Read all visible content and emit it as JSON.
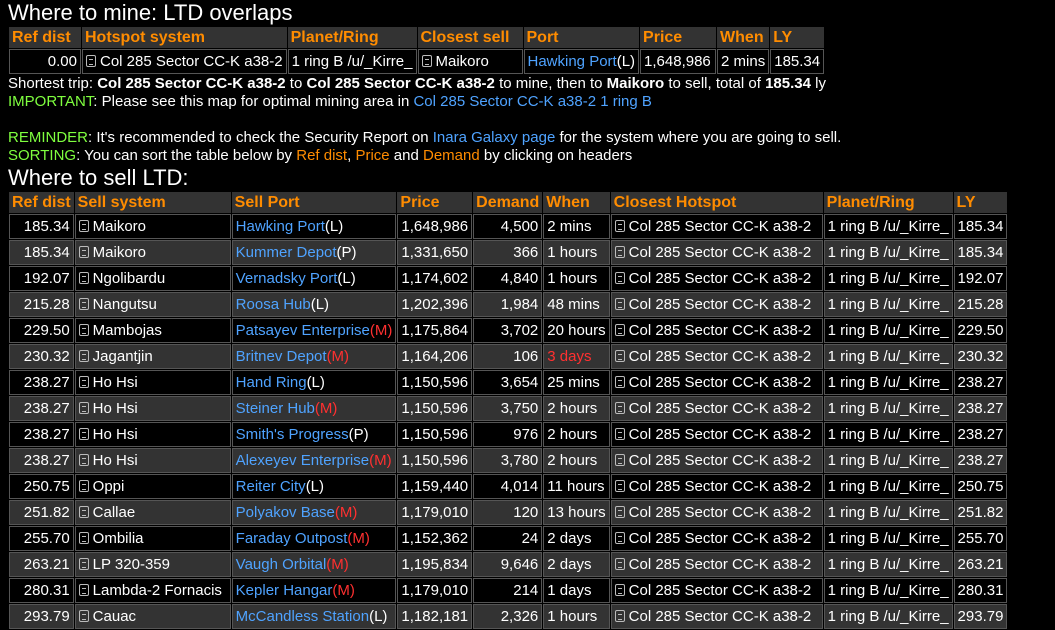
{
  "mine": {
    "title": "Where to mine: LTD overlaps",
    "headers": [
      "Ref dist",
      "Hotspot system",
      "Planet/Ring",
      "Closest sell",
      "Port",
      "Price",
      "When",
      "LY"
    ],
    "row": {
      "ref_dist": "0.00",
      "hotspot_system": "Col 285 Sector CC-K a38-2",
      "planet_ring": "1 ring B /u/_Kirre_",
      "closest_sell": "Maikoro",
      "port": "Hawking Port",
      "port_type": "(L)",
      "price": "1,648,986",
      "when": "2 mins",
      "ly": "185.34"
    }
  },
  "trip": {
    "lead": "Shortest trip:",
    "from": "Col 285 Sector CC-K a38-2",
    "to_word": "to",
    "to": "Col 285 Sector CC-K a38-2",
    "mine_then": "to mine, then to",
    "sell": "Maikoro",
    "sell_total": "to sell, total of",
    "total": "185.34",
    "unit": "ly"
  },
  "important": {
    "label": "IMPORTANT",
    "text": ": Please see this map for optimal mining area in",
    "link": "Col 285 Sector CC-K a38-2 1 ring B"
  },
  "reminder": {
    "label": "REMINDER",
    "text1": ": It's recommended to check the Security Report on",
    "link": "Inara Galaxy page",
    "text2": "for the system where you are going to sell."
  },
  "sorting": {
    "label": "SORTING",
    "text1": ": You can sort the table below by",
    "k1": "Ref dist",
    "sep": ",",
    "k2": "Price",
    "and": "and",
    "k3": "Demand",
    "text2": "by clicking on headers"
  },
  "sell": {
    "title": "Where to sell LTD:",
    "headers": [
      "Ref dist",
      "Sell system",
      "Sell Port",
      "Price",
      "Demand",
      "When",
      "Closest Hotspot",
      "Planet/Ring",
      "LY"
    ],
    "rows": [
      {
        "ref": "185.34",
        "system": "Maikoro",
        "port": "Hawking Port",
        "ptype": "(L)",
        "price": "1,648,986",
        "demand": "4,500",
        "when": "2 mins",
        "when_alert": false,
        "hotspot": "Col 285 Sector CC-K a38-2",
        "ring": "1 ring B /u/_Kirre_",
        "ly": "185.34"
      },
      {
        "ref": "185.34",
        "system": "Maikoro",
        "port": "Kummer Depot",
        "ptype": "(P)",
        "price": "1,331,650",
        "demand": "366",
        "when": "1 hours",
        "when_alert": false,
        "hotspot": "Col 285 Sector CC-K a38-2",
        "ring": "1 ring B /u/_Kirre_",
        "ly": "185.34"
      },
      {
        "ref": "192.07",
        "system": "Ngolibardu",
        "port": "Vernadsky Port",
        "ptype": "(L)",
        "price": "1,174,602",
        "demand": "4,840",
        "when": "1 hours",
        "when_alert": false,
        "hotspot": "Col 285 Sector CC-K a38-2",
        "ring": "1 ring B /u/_Kirre_",
        "ly": "192.07"
      },
      {
        "ref": "215.28",
        "system": "Nangutsu",
        "port": "Roosa Hub",
        "ptype": "(L)",
        "price": "1,202,396",
        "demand": "1,984",
        "when": "48 mins",
        "when_alert": false,
        "hotspot": "Col 285 Sector CC-K a38-2",
        "ring": "1 ring B /u/_Kirre_",
        "ly": "215.28"
      },
      {
        "ref": "229.50",
        "system": "Mambojas",
        "port": "Patsayev Enterprise",
        "ptype": "(M)",
        "price": "1,175,864",
        "demand": "3,702",
        "when": "20 hours",
        "when_alert": false,
        "hotspot": "Col 285 Sector CC-K a38-2",
        "ring": "1 ring B /u/_Kirre_",
        "ly": "229.50"
      },
      {
        "ref": "230.32",
        "system": "Jagantjin",
        "port": "Britnev Depot",
        "ptype": "(M)",
        "price": "1,164,206",
        "demand": "106",
        "when": "3 days",
        "when_alert": true,
        "hotspot": "Col 285 Sector CC-K a38-2",
        "ring": "1 ring B /u/_Kirre_",
        "ly": "230.32"
      },
      {
        "ref": "238.27",
        "system": "Ho Hsi",
        "port": "Hand Ring",
        "ptype": "(L)",
        "price": "1,150,596",
        "demand": "3,654",
        "when": "25 mins",
        "when_alert": false,
        "hotspot": "Col 285 Sector CC-K a38-2",
        "ring": "1 ring B /u/_Kirre_",
        "ly": "238.27"
      },
      {
        "ref": "238.27",
        "system": "Ho Hsi",
        "port": "Steiner Hub",
        "ptype": "(M)",
        "price": "1,150,596",
        "demand": "3,750",
        "when": "2 hours",
        "when_alert": false,
        "hotspot": "Col 285 Sector CC-K a38-2",
        "ring": "1 ring B /u/_Kirre_",
        "ly": "238.27"
      },
      {
        "ref": "238.27",
        "system": "Ho Hsi",
        "port": "Smith's Progress",
        "ptype": "(P)",
        "price": "1,150,596",
        "demand": "976",
        "when": "2 hours",
        "when_alert": false,
        "hotspot": "Col 285 Sector CC-K a38-2",
        "ring": "1 ring B /u/_Kirre_",
        "ly": "238.27"
      },
      {
        "ref": "238.27",
        "system": "Ho Hsi",
        "port": "Alexeyev Enterprise",
        "ptype": "(M)",
        "price": "1,150,596",
        "demand": "3,780",
        "when": "2 hours",
        "when_alert": false,
        "hotspot": "Col 285 Sector CC-K a38-2",
        "ring": "1 ring B /u/_Kirre_",
        "ly": "238.27"
      },
      {
        "ref": "250.75",
        "system": "Oppi",
        "port": "Reiter City",
        "ptype": "(L)",
        "price": "1,159,440",
        "demand": "4,014",
        "when": "11 hours",
        "when_alert": false,
        "hotspot": "Col 285 Sector CC-K a38-2",
        "ring": "1 ring B /u/_Kirre_",
        "ly": "250.75"
      },
      {
        "ref": "251.82",
        "system": "Callae",
        "port": "Polyakov Base",
        "ptype": "(M)",
        "price": "1,179,010",
        "demand": "120",
        "when": "13 hours",
        "when_alert": false,
        "hotspot": "Col 285 Sector CC-K a38-2",
        "ring": "1 ring B /u/_Kirre_",
        "ly": "251.82"
      },
      {
        "ref": "255.70",
        "system": "Ombilia",
        "port": "Faraday Outpost",
        "ptype": "(M)",
        "price": "1,152,362",
        "demand": "24",
        "when": "2 days",
        "when_alert": false,
        "hotspot": "Col 285 Sector CC-K a38-2",
        "ring": "1 ring B /u/_Kirre_",
        "ly": "255.70"
      },
      {
        "ref": "263.21",
        "system": "LP 320-359",
        "port": "Vaugh Orbital",
        "ptype": "(M)",
        "price": "1,195,834",
        "demand": "9,646",
        "when": "2 days",
        "when_alert": false,
        "hotspot": "Col 285 Sector CC-K a38-2",
        "ring": "1 ring B /u/_Kirre_",
        "ly": "263.21"
      },
      {
        "ref": "280.31",
        "system": "Lambda-2 Fornacis",
        "port": "Kepler Hangar",
        "ptype": "(M)",
        "price": "1,179,010",
        "demand": "214",
        "when": "1 days",
        "when_alert": false,
        "hotspot": "Col 285 Sector CC-K a38-2",
        "ring": "1 ring B /u/_Kirre_",
        "ly": "280.31"
      },
      {
        "ref": "293.79",
        "system": "Cauac",
        "port": "McCandless Station",
        "ptype": "(L)",
        "price": "1,182,181",
        "demand": "2,326",
        "when": "1 hours",
        "when_alert": false,
        "hotspot": "Col 285 Sector CC-K a38-2",
        "ring": "1 ring B /u/_Kirre_",
        "ly": "293.79"
      }
    ]
  },
  "colors": {
    "header_text": "#ff8c00",
    "link": "#4fa3ff",
    "label_green": "#7fff3f",
    "alert_red": "#ff3030",
    "row_alt": "#333333"
  },
  "icons": {
    "copy": "copy-icon"
  }
}
